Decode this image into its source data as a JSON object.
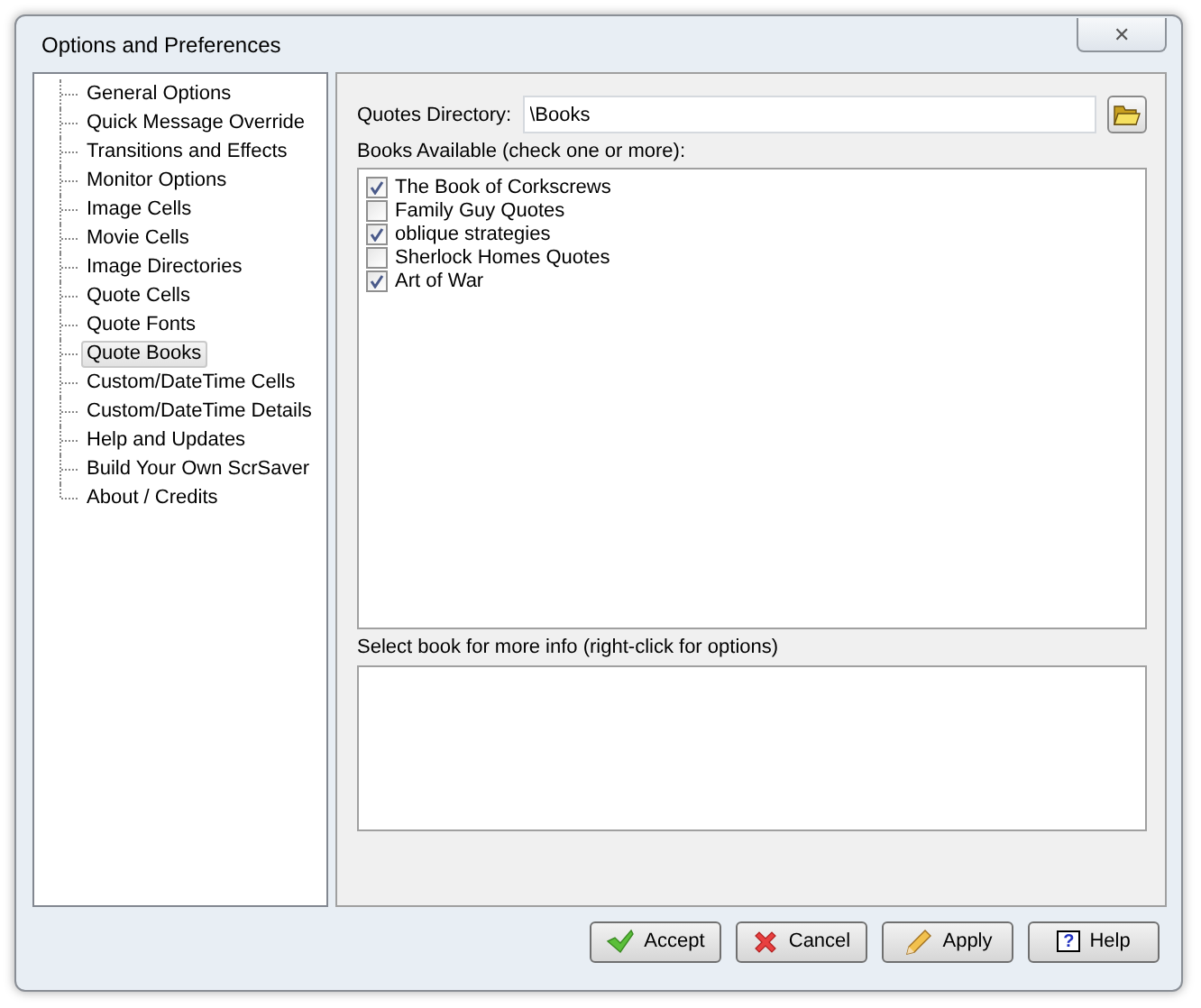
{
  "window": {
    "title": "Options and Preferences",
    "close": "✕"
  },
  "sidebar": {
    "items": [
      {
        "label": "General Options",
        "selected": false
      },
      {
        "label": "Quick Message Override",
        "selected": false
      },
      {
        "label": "Transitions and Effects",
        "selected": false
      },
      {
        "label": "Monitor Options",
        "selected": false
      },
      {
        "label": "Image Cells",
        "selected": false
      },
      {
        "label": "Movie Cells",
        "selected": false
      },
      {
        "label": "Image Directories",
        "selected": false
      },
      {
        "label": "Quote Cells",
        "selected": false
      },
      {
        "label": "Quote Fonts",
        "selected": false
      },
      {
        "label": "Quote Books",
        "selected": true
      },
      {
        "label": "Custom/DateTime Cells",
        "selected": false
      },
      {
        "label": "Custom/DateTime Details",
        "selected": false
      },
      {
        "label": "Help and Updates",
        "selected": false
      },
      {
        "label": "Build Your Own ScrSaver",
        "selected": false
      },
      {
        "label": "About / Credits",
        "selected": false
      }
    ]
  },
  "directory": {
    "label": "Quotes Directory:",
    "value": "\\Books"
  },
  "books": {
    "label": "Books Available (check one or more):",
    "items": [
      {
        "label": "The Book of Corkscrews",
        "checked": true
      },
      {
        "label": "Family Guy Quotes",
        "checked": false
      },
      {
        "label": "oblique strategies",
        "checked": true
      },
      {
        "label": "Sherlock Homes Quotes",
        "checked": false
      },
      {
        "label": "Art of War",
        "checked": true
      }
    ]
  },
  "info": {
    "label": "Select book for more info (right-click for options)"
  },
  "buttons": [
    {
      "label": "Accept",
      "kind": "accept"
    },
    {
      "label": "Cancel",
      "kind": "cancel"
    },
    {
      "label": "Apply",
      "kind": "apply"
    },
    {
      "label": "Help",
      "kind": "help",
      "icon": "?"
    }
  ]
}
